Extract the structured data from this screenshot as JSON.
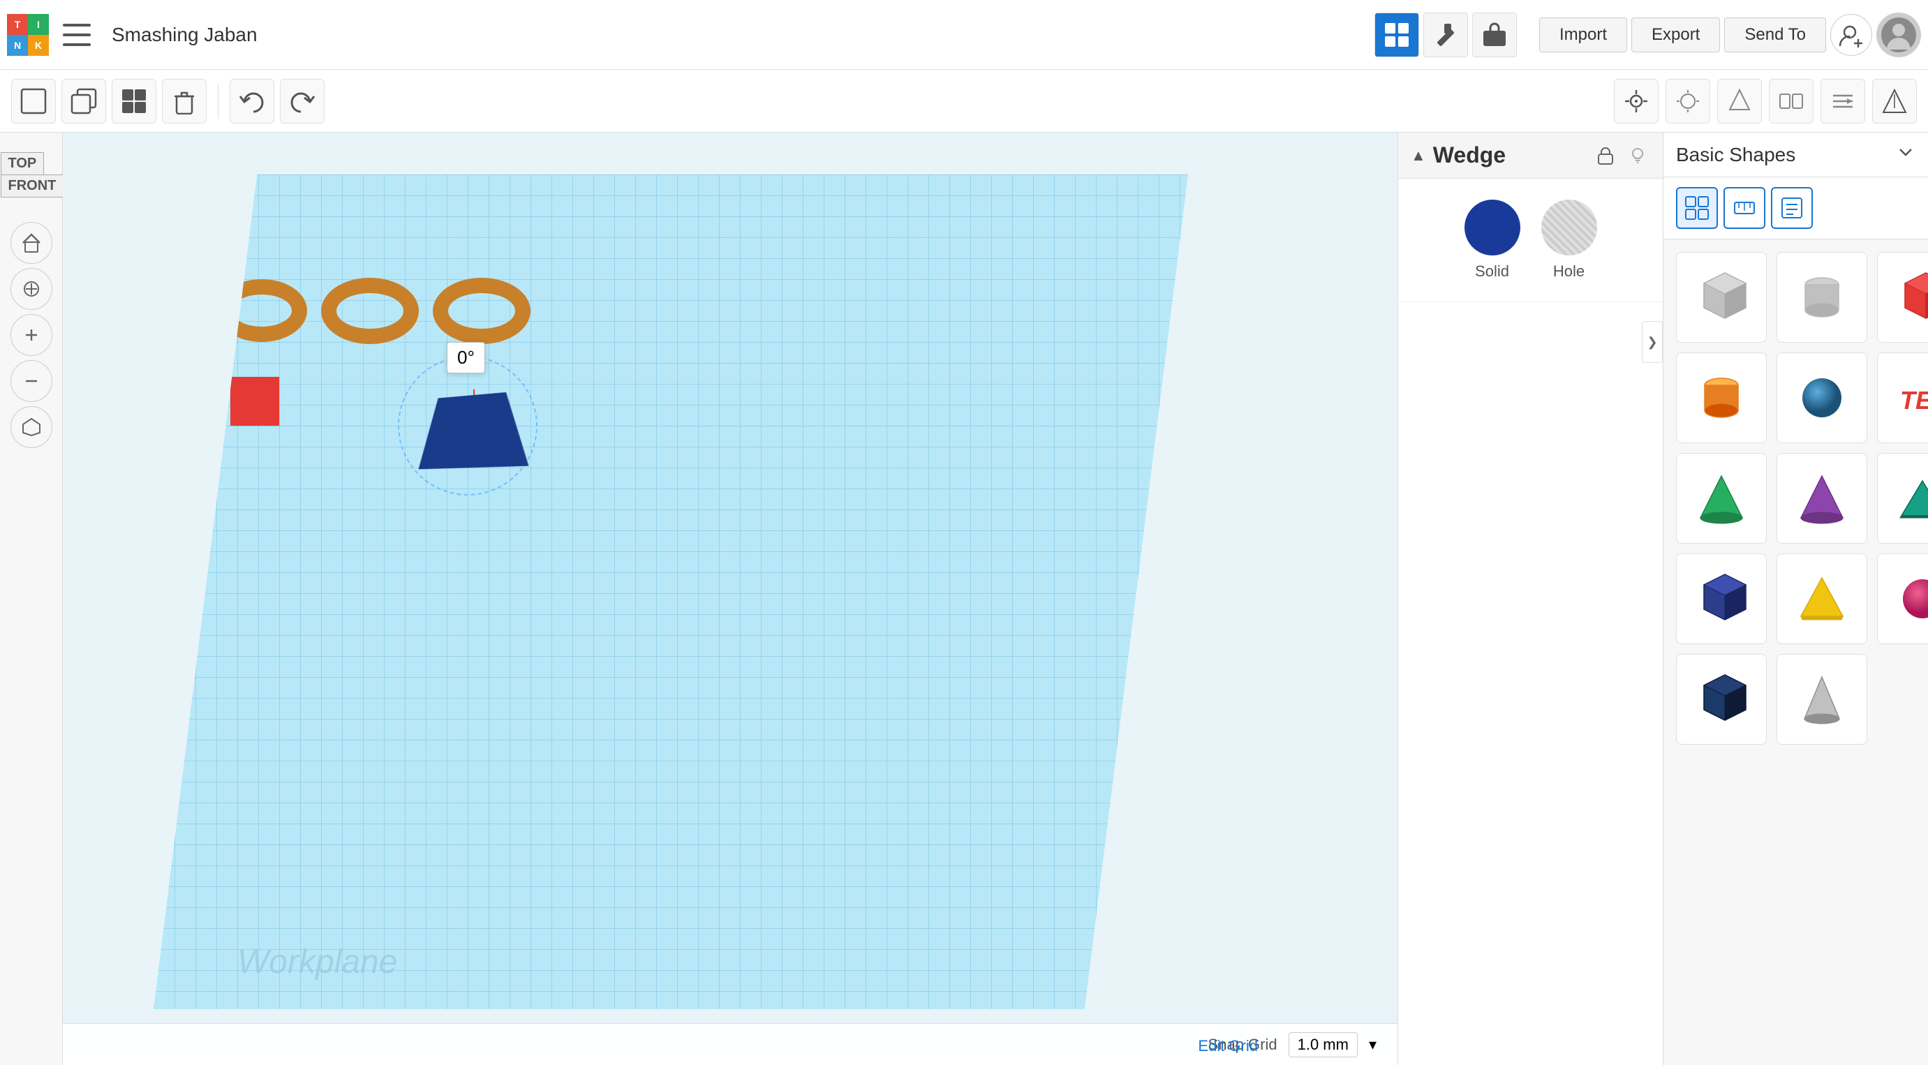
{
  "app": {
    "logo": {
      "t": "T",
      "i": "I",
      "n": "N",
      "k": "K"
    },
    "title": "Smashing Jaban"
  },
  "topbar": {
    "nav_icons": [
      "grid-icon",
      "hammer-icon",
      "briefcase-icon"
    ],
    "actions": [
      "Import",
      "Export",
      "Send To"
    ],
    "user_add_label": "+",
    "profile_icon": "profile-icon"
  },
  "toolbar": {
    "tools": [
      {
        "name": "new-shape-btn",
        "icon": "⬜",
        "label": "New Shape"
      },
      {
        "name": "copy-btn",
        "icon": "⧉",
        "label": "Copy"
      },
      {
        "name": "duplicate-btn",
        "icon": "⬛",
        "label": "Duplicate"
      },
      {
        "name": "delete-btn",
        "icon": "🗑",
        "label": "Delete"
      },
      {
        "name": "undo-btn",
        "icon": "↩",
        "label": "Undo"
      },
      {
        "name": "redo-btn",
        "icon": "↪",
        "label": "Redo"
      }
    ],
    "right_tools": [
      {
        "name": "camera-btn",
        "icon": "👁"
      },
      {
        "name": "light-btn",
        "icon": "○"
      },
      {
        "name": "shape-tool",
        "icon": "◇"
      },
      {
        "name": "mirror-btn",
        "icon": "◈"
      },
      {
        "name": "align-btn",
        "icon": "⚌"
      },
      {
        "name": "ruler-btn",
        "icon": "△"
      }
    ]
  },
  "viewport": {
    "view_cube_top": "TOP",
    "view_cube_front": "FRONT",
    "workplane_label": "Workplane",
    "rotation_angle": "0°",
    "snap_label": "Snap Grid",
    "snap_value": "1.0 mm",
    "edit_grid": "Edit Grid"
  },
  "nav_buttons": [
    {
      "name": "home-nav-btn",
      "icon": "⌂"
    },
    {
      "name": "fit-nav-btn",
      "icon": "⊙"
    },
    {
      "name": "zoom-in-btn",
      "icon": "+"
    },
    {
      "name": "zoom-out-btn",
      "icon": "−"
    },
    {
      "name": "perspective-btn",
      "icon": "⬡"
    }
  ],
  "shape_panel": {
    "title": "Wedge",
    "lock_icon": "🔒",
    "bulb_icon": "💡",
    "solid_label": "Solid",
    "hole_label": "Hole",
    "collapse_icon": "❯"
  },
  "shapes_library": {
    "title": "Basic Shapes",
    "dropdown_icon": "⌄",
    "tab_icons": [
      "grid-tab",
      "ruler-tab",
      "notes-tab"
    ],
    "shapes": [
      {
        "name": "box-shape",
        "color": "#b0b0b0",
        "type": "box-gray"
      },
      {
        "name": "cylinder-gray",
        "color": "#b0b0b0",
        "type": "cyl-gray"
      },
      {
        "name": "box-red",
        "color": "#e53935",
        "type": "box-red"
      },
      {
        "name": "cylinder-orange",
        "color": "#e67e22",
        "type": "cyl-orange"
      },
      {
        "name": "sphere-blue",
        "color": "#2980b9",
        "type": "sphere-blue"
      },
      {
        "name": "text-shape",
        "color": "#e53935",
        "type": "text-red"
      },
      {
        "name": "cone-green",
        "color": "#27ae60",
        "type": "cone-green"
      },
      {
        "name": "cone-purple",
        "color": "#8e44ad",
        "type": "cone-purple"
      },
      {
        "name": "wedge-teal",
        "color": "#16a085",
        "type": "wedge-teal"
      },
      {
        "name": "box-blue",
        "color": "#2c3e8a",
        "type": "box-blue"
      },
      {
        "name": "pyramid-yellow",
        "color": "#f1c40f",
        "type": "pyramid-yellow"
      },
      {
        "name": "sphere-pink",
        "color": "#e91e8c",
        "type": "sphere-pink"
      },
      {
        "name": "box-navy",
        "color": "#1a3a6a",
        "type": "box-navy"
      },
      {
        "name": "cone-gray",
        "color": "#aaaaaa",
        "type": "cone-gray"
      }
    ]
  }
}
